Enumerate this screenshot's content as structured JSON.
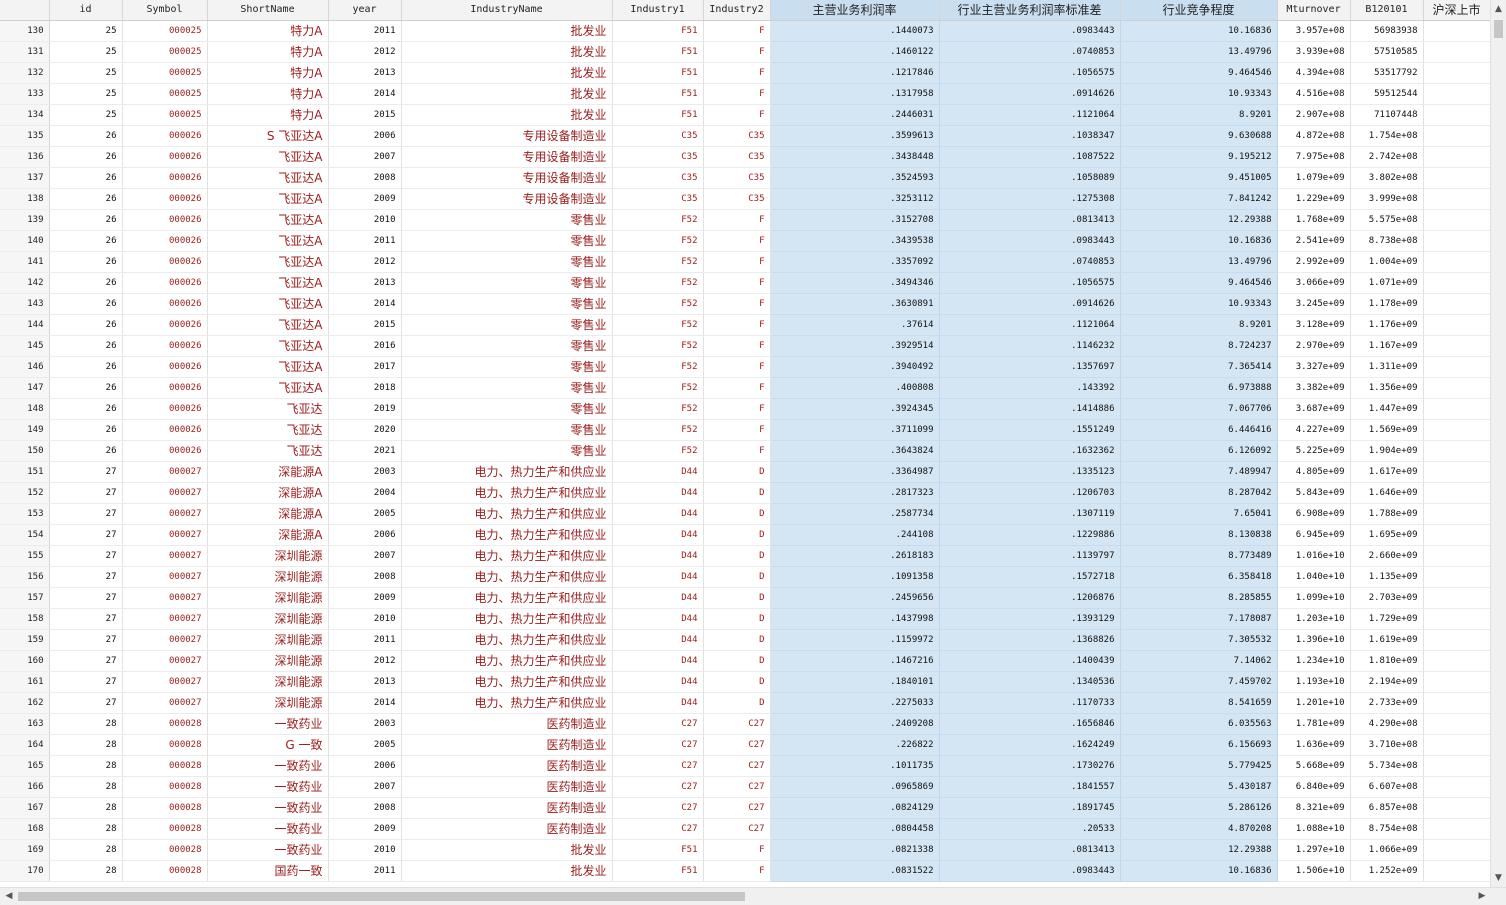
{
  "columns": [
    {
      "key": "rownum",
      "label": "",
      "cls": "rn",
      "width": 49
    },
    {
      "key": "id",
      "label": "id",
      "cls": "",
      "width": 73
    },
    {
      "key": "Symbol",
      "label": "Symbol",
      "cls": "str",
      "width": 85
    },
    {
      "key": "ShortName",
      "label": "ShortName",
      "cls": "str zh",
      "width": 121
    },
    {
      "key": "year",
      "label": "year",
      "cls": "",
      "width": 73
    },
    {
      "key": "IndustryName",
      "label": "IndustryName",
      "cls": "str zh",
      "width": 211
    },
    {
      "key": "Industry1",
      "label": "Industry1",
      "cls": "str",
      "width": 91
    },
    {
      "key": "Industry2",
      "label": "Industry2",
      "cls": "str",
      "width": 67
    },
    {
      "key": "c1",
      "label": "主营业务利润率",
      "cls": "sel",
      "width": 169,
      "zh": true
    },
    {
      "key": "c2",
      "label": "行业主营业务利润率标准差",
      "cls": "sel",
      "width": 181,
      "zh": true
    },
    {
      "key": "c3",
      "label": "行业竞争程度",
      "cls": "sel",
      "width": 157,
      "zh": true
    },
    {
      "key": "Mturnover",
      "label": "Mturnover",
      "cls": "",
      "width": 73
    },
    {
      "key": "B120101",
      "label": "B120101",
      "cls": "",
      "width": 73
    },
    {
      "key": "ipo",
      "label": "沪深上市",
      "cls": "",
      "width": 67,
      "zh": true
    }
  ],
  "rows": [
    [
      "130",
      "25",
      "000025",
      "特力A",
      "2011",
      "批发业",
      "F51",
      "F",
      ".1440073",
      ".0983443",
      "10.16836",
      "3.957e+08",
      "56983938",
      ""
    ],
    [
      "131",
      "25",
      "000025",
      "特力A",
      "2012",
      "批发业",
      "F51",
      "F",
      ".1460122",
      ".0740853",
      "13.49796",
      "3.939e+08",
      "57510585",
      ""
    ],
    [
      "132",
      "25",
      "000025",
      "特力A",
      "2013",
      "批发业",
      "F51",
      "F",
      ".1217846",
      ".1056575",
      "9.464546",
      "4.394e+08",
      "53517792",
      ""
    ],
    [
      "133",
      "25",
      "000025",
      "特力A",
      "2014",
      "批发业",
      "F51",
      "F",
      ".1317958",
      ".0914626",
      "10.93343",
      "4.516e+08",
      "59512544",
      ""
    ],
    [
      "134",
      "25",
      "000025",
      "特力A",
      "2015",
      "批发业",
      "F51",
      "F",
      ".2446031",
      ".1121064",
      "8.9201",
      "2.907e+08",
      "71107448",
      ""
    ],
    [
      "135",
      "26",
      "000026",
      "S 飞亚达A",
      "2006",
      "专用设备制造业",
      "C35",
      "C35",
      ".3599613",
      ".1038347",
      "9.630688",
      "4.872e+08",
      "1.754e+08",
      ""
    ],
    [
      "136",
      "26",
      "000026",
      "飞亚达A",
      "2007",
      "专用设备制造业",
      "C35",
      "C35",
      ".3438448",
      ".1087522",
      "9.195212",
      "7.975e+08",
      "2.742e+08",
      ""
    ],
    [
      "137",
      "26",
      "000026",
      "飞亚达A",
      "2008",
      "专用设备制造业",
      "C35",
      "C35",
      ".3524593",
      ".1058089",
      "9.451005",
      "1.079e+09",
      "3.802e+08",
      ""
    ],
    [
      "138",
      "26",
      "000026",
      "飞亚达A",
      "2009",
      "专用设备制造业",
      "C35",
      "C35",
      ".3253112",
      ".1275308",
      "7.841242",
      "1.229e+09",
      "3.999e+08",
      ""
    ],
    [
      "139",
      "26",
      "000026",
      "飞亚达A",
      "2010",
      "零售业",
      "F52",
      "F",
      ".3152708",
      ".0813413",
      "12.29388",
      "1.768e+09",
      "5.575e+08",
      ""
    ],
    [
      "140",
      "26",
      "000026",
      "飞亚达A",
      "2011",
      "零售业",
      "F52",
      "F",
      ".3439538",
      ".0983443",
      "10.16836",
      "2.541e+09",
      "8.738e+08",
      ""
    ],
    [
      "141",
      "26",
      "000026",
      "飞亚达A",
      "2012",
      "零售业",
      "F52",
      "F",
      ".3357092",
      ".0740853",
      "13.49796",
      "2.992e+09",
      "1.004e+09",
      ""
    ],
    [
      "142",
      "26",
      "000026",
      "飞亚达A",
      "2013",
      "零售业",
      "F52",
      "F",
      ".3494346",
      ".1056575",
      "9.464546",
      "3.066e+09",
      "1.071e+09",
      ""
    ],
    [
      "143",
      "26",
      "000026",
      "飞亚达A",
      "2014",
      "零售业",
      "F52",
      "F",
      ".3630891",
      ".0914626",
      "10.93343",
      "3.245e+09",
      "1.178e+09",
      ""
    ],
    [
      "144",
      "26",
      "000026",
      "飞亚达A",
      "2015",
      "零售业",
      "F52",
      "F",
      ".37614",
      ".1121064",
      "8.9201",
      "3.128e+09",
      "1.176e+09",
      ""
    ],
    [
      "145",
      "26",
      "000026",
      "飞亚达A",
      "2016",
      "零售业",
      "F52",
      "F",
      ".3929514",
      ".1146232",
      "8.724237",
      "2.970e+09",
      "1.167e+09",
      ""
    ],
    [
      "146",
      "26",
      "000026",
      "飞亚达A",
      "2017",
      "零售业",
      "F52",
      "F",
      ".3940492",
      ".1357697",
      "7.365414",
      "3.327e+09",
      "1.311e+09",
      ""
    ],
    [
      "147",
      "26",
      "000026",
      "飞亚达A",
      "2018",
      "零售业",
      "F52",
      "F",
      ".400808",
      ".143392",
      "6.973888",
      "3.382e+09",
      "1.356e+09",
      ""
    ],
    [
      "148",
      "26",
      "000026",
      "飞亚达",
      "2019",
      "零售业",
      "F52",
      "F",
      ".3924345",
      ".1414886",
      "7.067706",
      "3.687e+09",
      "1.447e+09",
      ""
    ],
    [
      "149",
      "26",
      "000026",
      "飞亚达",
      "2020",
      "零售业",
      "F52",
      "F",
      ".3711099",
      ".1551249",
      "6.446416",
      "4.227e+09",
      "1.569e+09",
      ""
    ],
    [
      "150",
      "26",
      "000026",
      "飞亚达",
      "2021",
      "零售业",
      "F52",
      "F",
      ".3643824",
      ".1632362",
      "6.126092",
      "5.225e+09",
      "1.904e+09",
      ""
    ],
    [
      "151",
      "27",
      "000027",
      "深能源A",
      "2003",
      "电力、热力生产和供应业",
      "D44",
      "D",
      ".3364987",
      ".1335123",
      "7.489947",
      "4.805e+09",
      "1.617e+09",
      ""
    ],
    [
      "152",
      "27",
      "000027",
      "深能源A",
      "2004",
      "电力、热力生产和供应业",
      "D44",
      "D",
      ".2817323",
      ".1206703",
      "8.287042",
      "5.843e+09",
      "1.646e+09",
      ""
    ],
    [
      "153",
      "27",
      "000027",
      "深能源A",
      "2005",
      "电力、热力生产和供应业",
      "D44",
      "D",
      ".2587734",
      ".1307119",
      "7.65041",
      "6.908e+09",
      "1.788e+09",
      ""
    ],
    [
      "154",
      "27",
      "000027",
      "深能源A",
      "2006",
      "电力、热力生产和供应业",
      "D44",
      "D",
      ".244108",
      ".1229886",
      "8.130838",
      "6.945e+09",
      "1.695e+09",
      ""
    ],
    [
      "155",
      "27",
      "000027",
      "深圳能源",
      "2007",
      "电力、热力生产和供应业",
      "D44",
      "D",
      ".2618183",
      ".1139797",
      "8.773489",
      "1.016e+10",
      "2.660e+09",
      ""
    ],
    [
      "156",
      "27",
      "000027",
      "深圳能源",
      "2008",
      "电力、热力生产和供应业",
      "D44",
      "D",
      ".1091358",
      ".1572718",
      "6.358418",
      "1.040e+10",
      "1.135e+09",
      ""
    ],
    [
      "157",
      "27",
      "000027",
      "深圳能源",
      "2009",
      "电力、热力生产和供应业",
      "D44",
      "D",
      ".2459656",
      ".1206876",
      "8.285855",
      "1.099e+10",
      "2.703e+09",
      ""
    ],
    [
      "158",
      "27",
      "000027",
      "深圳能源",
      "2010",
      "电力、热力生产和供应业",
      "D44",
      "D",
      ".1437998",
      ".1393129",
      "7.178087",
      "1.203e+10",
      "1.729e+09",
      ""
    ],
    [
      "159",
      "27",
      "000027",
      "深圳能源",
      "2011",
      "电力、热力生产和供应业",
      "D44",
      "D",
      ".1159972",
      ".1368826",
      "7.305532",
      "1.396e+10",
      "1.619e+09",
      ""
    ],
    [
      "160",
      "27",
      "000027",
      "深圳能源",
      "2012",
      "电力、热力生产和供应业",
      "D44",
      "D",
      ".1467216",
      ".1400439",
      "7.14062",
      "1.234e+10",
      "1.810e+09",
      ""
    ],
    [
      "161",
      "27",
      "000027",
      "深圳能源",
      "2013",
      "电力、热力生产和供应业",
      "D44",
      "D",
      ".1840101",
      ".1340536",
      "7.459702",
      "1.193e+10",
      "2.194e+09",
      ""
    ],
    [
      "162",
      "27",
      "000027",
      "深圳能源",
      "2014",
      "电力、热力生产和供应业",
      "D44",
      "D",
      ".2275033",
      ".1170733",
      "8.541659",
      "1.201e+10",
      "2.733e+09",
      ""
    ],
    [
      "163",
      "28",
      "000028",
      "一致药业",
      "2003",
      "医药制造业",
      "C27",
      "C27",
      ".2409208",
      ".1656846",
      "6.035563",
      "1.781e+09",
      "4.290e+08",
      ""
    ],
    [
      "164",
      "28",
      "000028",
      "G 一致",
      "2005",
      "医药制造业",
      "C27",
      "C27",
      ".226822",
      ".1624249",
      "6.156693",
      "1.636e+09",
      "3.710e+08",
      ""
    ],
    [
      "165",
      "28",
      "000028",
      "一致药业",
      "2006",
      "医药制造业",
      "C27",
      "C27",
      ".1011735",
      ".1730276",
      "5.779425",
      "5.668e+09",
      "5.734e+08",
      ""
    ],
    [
      "166",
      "28",
      "000028",
      "一致药业",
      "2007",
      "医药制造业",
      "C27",
      "C27",
      ".0965869",
      ".1841557",
      "5.430187",
      "6.840e+09",
      "6.607e+08",
      ""
    ],
    [
      "167",
      "28",
      "000028",
      "一致药业",
      "2008",
      "医药制造业",
      "C27",
      "C27",
      ".0824129",
      ".1891745",
      "5.286126",
      "8.321e+09",
      "6.857e+08",
      ""
    ],
    [
      "168",
      "28",
      "000028",
      "一致药业",
      "2009",
      "医药制造业",
      "C27",
      "C27",
      ".0804458",
      ".20533",
      "4.870208",
      "1.088e+10",
      "8.754e+08",
      ""
    ],
    [
      "169",
      "28",
      "000028",
      "一致药业",
      "2010",
      "批发业",
      "F51",
      "F",
      ".0821338",
      ".0813413",
      "12.29388",
      "1.297e+10",
      "1.066e+09",
      ""
    ],
    [
      "170",
      "28",
      "000028",
      "国药一致",
      "2011",
      "批发业",
      "F51",
      "F",
      ".0831522",
      ".0983443",
      "10.16836",
      "1.506e+10",
      "1.252e+09",
      ""
    ]
  ],
  "scroll": {
    "up_icon": "▲",
    "down_icon": "▼",
    "left_icon": "◀",
    "right_icon": "▶"
  }
}
